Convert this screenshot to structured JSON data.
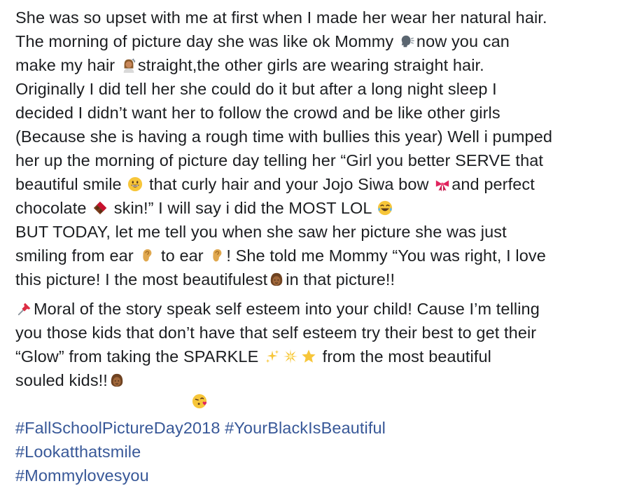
{
  "post": {
    "paragraph1": {
      "l1": "She was so upset with me at first when I made her wear her natural hair.",
      "l2a": "The morning of picture day she was like ok Mommy ",
      "l2b": "now you can",
      "l3a": "make my hair ",
      "l3b": "straight,the other girls are wearing straight hair.",
      "l4": "Originally I did tell her she could do it but after a long night sleep I",
      "l5": "decided I didn’t want her to follow the crowd and be like other girls",
      "l6": "(Because she is having a rough time with bullies this year) Well i pumped",
      "l7": "her up the morning of picture day telling her “Girl you better SERVE that",
      "l8a": "beautiful smile ",
      "l8b": " that curly hair and your Jojo Siwa bow ",
      "l8c": "and perfect",
      "l9a": "chocolate ",
      "l9b": " skin!” I will say i did the MOST LOL ",
      "l10": "BUT TODAY, let me tell you when she saw her picture she was just",
      "l11a": "smiling from ear ",
      "l11b": " to ear ",
      "l11c": "! She told me Mommy “You was right, I love",
      "l12a": "this picture! I the most beautifulest",
      "l12b": "in that picture!!"
    },
    "paragraph2": {
      "l1": "Moral of the story speak self esteem into your child! Cause I’m telling",
      "l2": "you those kids that don’t have that self esteem try their best to get their",
      "l3a": "“Glow” from taking the SPARKLE ",
      "l3b": " from the most beautiful",
      "l4": "souled kids!!"
    },
    "hashtags": {
      "line1a": "#FallSchoolPictureDay2018",
      "line1b": "#YourBlackIsBeautiful",
      "line2": "#Lookatthatsmile",
      "line3": "#Mommylovesyou"
    },
    "emoji_names": [
      "speaking-head-icon",
      "haircut-woman-icon",
      "grinning-face-icon",
      "ribbon-icon",
      "chocolate-bar-icon",
      "tears-of-joy-icon",
      "ear-icon",
      "woman-face-icon",
      "pushpin-icon",
      "sparkles-icon",
      "glowing-star-icon",
      "star-icon",
      "kissing-heart-icon"
    ],
    "colors": {
      "text": "#1c1e21",
      "hashtag": "#385898"
    }
  }
}
